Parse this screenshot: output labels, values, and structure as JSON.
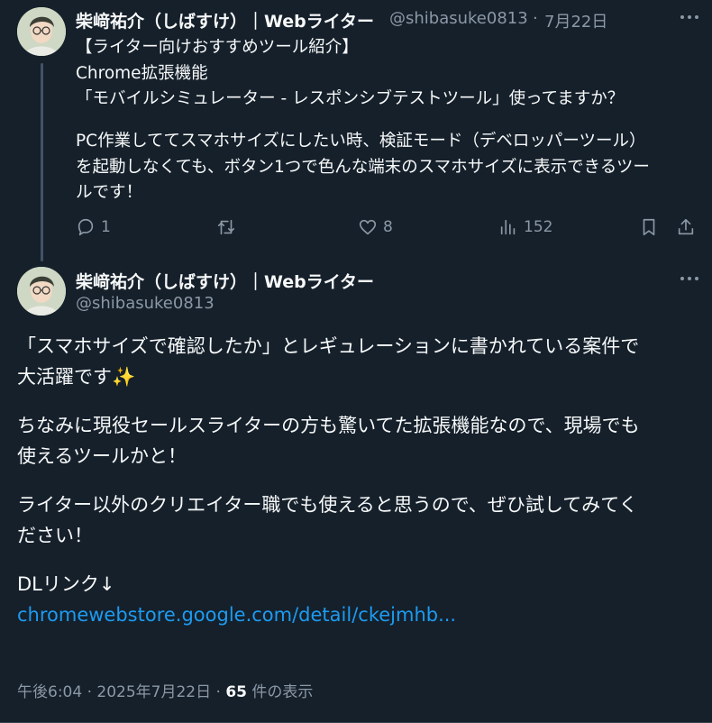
{
  "colors": {
    "background": "#15202b",
    "text": "#f7f9f9",
    "muted": "#8b98a5",
    "link": "#1d9bf0"
  },
  "tweet1": {
    "author_name": "柴﨑祐介（しばすけ）｜Webライター",
    "handle": "@shibasuke0813",
    "separator": "·",
    "date": "7月22日",
    "more_icon": "more-horizontal-icon",
    "lines": [
      "【ライター向けおすすめツール紹介】",
      "Chrome拡張機能",
      "「モバイルシミュレーター - レスポンシブテストツール」使ってますか？",
      "",
      "PC作業しててスマホサイズにしたい時、検証モード（デベロッパーツール）",
      "を起動しなくても、ボタン1つで色んな端末のスマホサイズに表示できるツー",
      "ルです！"
    ],
    "actions": {
      "reply_count": "1",
      "retweet_count": "",
      "like_count": "8",
      "views_count": "152"
    }
  },
  "tweet2": {
    "author_name": "柴﨑祐介（しばすけ）｜Webライター",
    "handle": "@shibasuke0813",
    "more_icon": "more-horizontal-icon",
    "lines": [
      "「スマホサイズで確認したか」とレギュレーションに書かれている案件で",
      "大活躍です✨",
      "",
      "ちなみに現役セールスライターの方も驚いてた拡張機能なので、現場でも",
      "使えるツールかと！",
      "",
      "ライター以外のクリエイター職でも使えると思うので、ぜひ試してみてく",
      "ださい！",
      "",
      "DLリンク↓"
    ],
    "link": "chromewebstore.google.com/detail/ckejmhb...",
    "time": "午後6:04",
    "separator": "·",
    "date": "2025年7月22日",
    "views_count": "65",
    "views_label": "件の表示"
  }
}
